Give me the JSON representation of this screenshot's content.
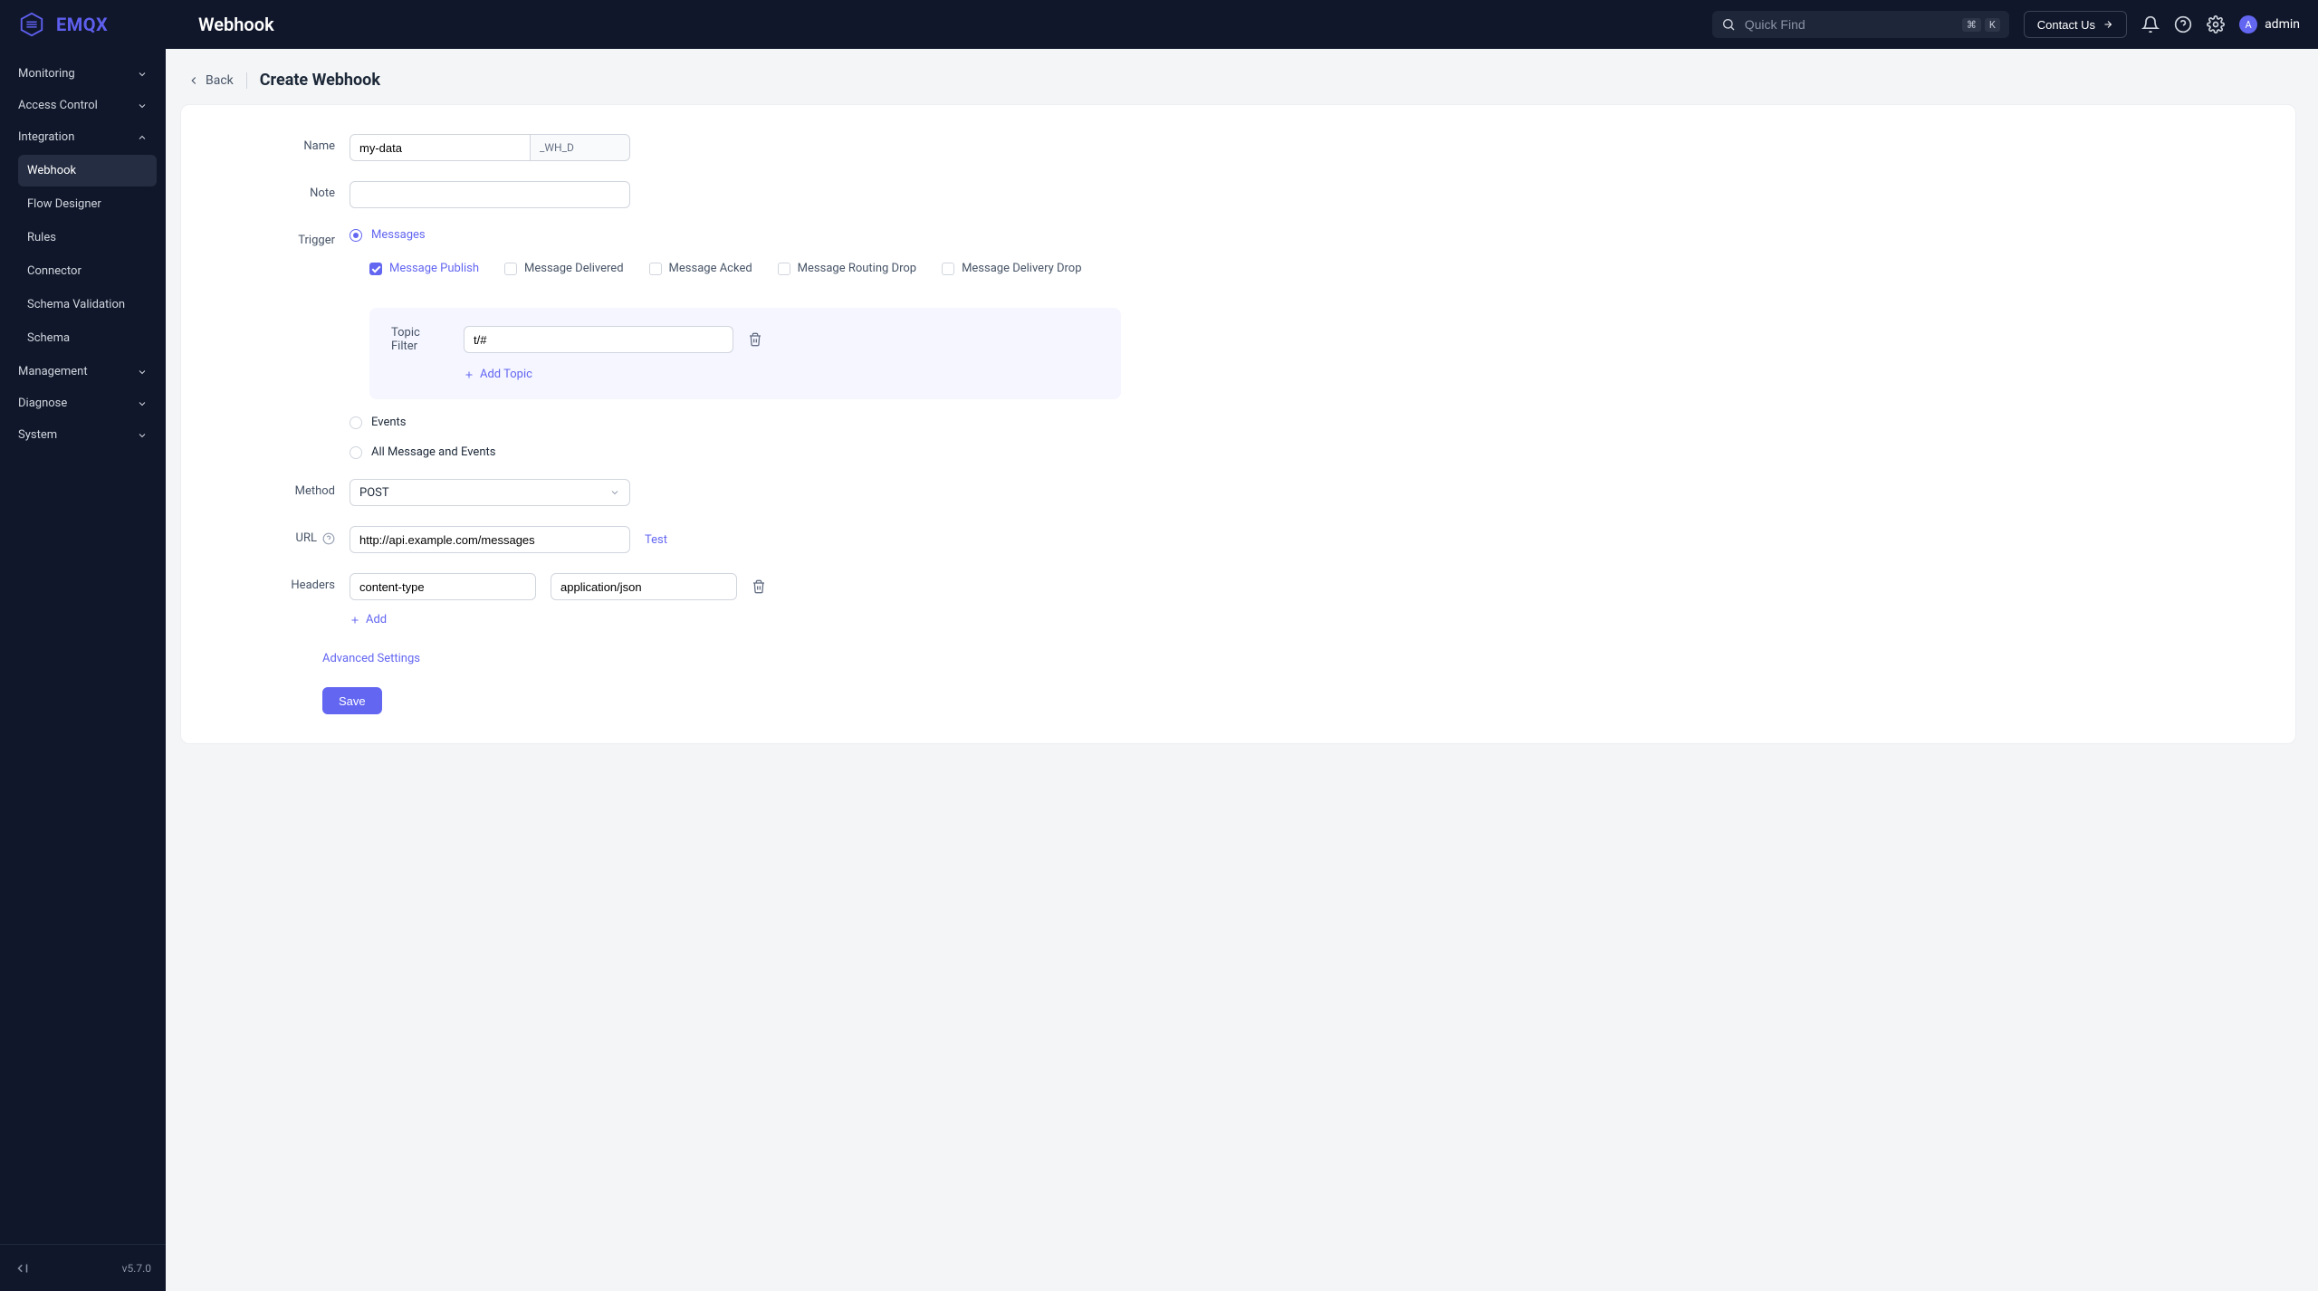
{
  "brand": "EMQX",
  "page_title": "Webhook",
  "search": {
    "placeholder": "Quick Find",
    "kbd1": "⌘",
    "kbd2": "K"
  },
  "header": {
    "contact": "Contact Us",
    "avatar_letter": "A",
    "username": "admin"
  },
  "sidebar": {
    "groups": [
      {
        "label": "Monitoring",
        "expanded": false
      },
      {
        "label": "Access Control",
        "expanded": false
      },
      {
        "label": "Integration",
        "expanded": true,
        "items": [
          "Webhook",
          "Flow Designer",
          "Rules",
          "Connector",
          "Schema Validation",
          "Schema"
        ],
        "active_index": 0
      },
      {
        "label": "Management",
        "expanded": false
      },
      {
        "label": "Diagnose",
        "expanded": false
      },
      {
        "label": "System",
        "expanded": false
      }
    ],
    "version": "v5.7.0"
  },
  "breadcrumb": {
    "back": "Back",
    "title": "Create Webhook"
  },
  "form": {
    "labels": {
      "name": "Name",
      "note": "Note",
      "trigger": "Trigger",
      "method": "Method",
      "url": "URL",
      "headers": "Headers",
      "topic_filter": "Topic Filter"
    },
    "name_value": "my-data",
    "name_suffix": "_WH_D",
    "note_value": "",
    "trigger": {
      "options": [
        "Messages",
        "Events",
        "All Message and Events"
      ],
      "selected": 0,
      "message_events": [
        {
          "label": "Message Publish",
          "checked": true
        },
        {
          "label": "Message Delivered",
          "checked": false
        },
        {
          "label": "Message Acked",
          "checked": false
        },
        {
          "label": "Message Routing Drop",
          "checked": false
        },
        {
          "label": "Message Delivery Drop",
          "checked": false
        }
      ],
      "topic_filter_value": "t/#",
      "add_topic": "Add Topic"
    },
    "method_value": "POST",
    "url_value": "http://api.example.com/messages",
    "test_label": "Test",
    "headers_list": [
      {
        "key": "content-type",
        "value": "application/json"
      }
    ],
    "add_header": "Add",
    "advanced": "Advanced Settings",
    "save": "Save"
  }
}
